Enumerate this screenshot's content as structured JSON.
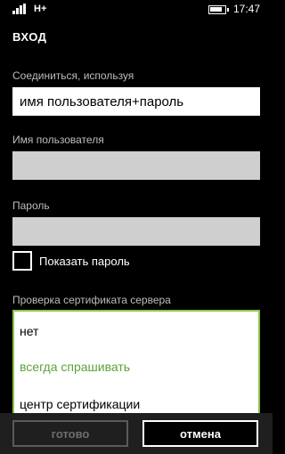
{
  "status_bar": {
    "network": "H+",
    "time": "17:47"
  },
  "page": {
    "title": "ВХОД"
  },
  "form": {
    "connect_label": "Соединиться, используя",
    "connect_value": "имя пользователя+пароль",
    "username_label": "Имя пользователя",
    "username_value": "",
    "password_label": "Пароль",
    "password_value": "",
    "show_password_label": "Показать пароль",
    "show_password_checked": false,
    "cert_label": "Проверка сертификата сервера",
    "cert_options": [
      "нет",
      "всегда спрашивать",
      "центр сертификации"
    ],
    "cert_selected": "всегда спрашивать"
  },
  "app_bar": {
    "ok_label": "готово",
    "cancel_label": "отмена"
  },
  "colors": {
    "accent": "#5aa33b",
    "background": "#000000"
  }
}
